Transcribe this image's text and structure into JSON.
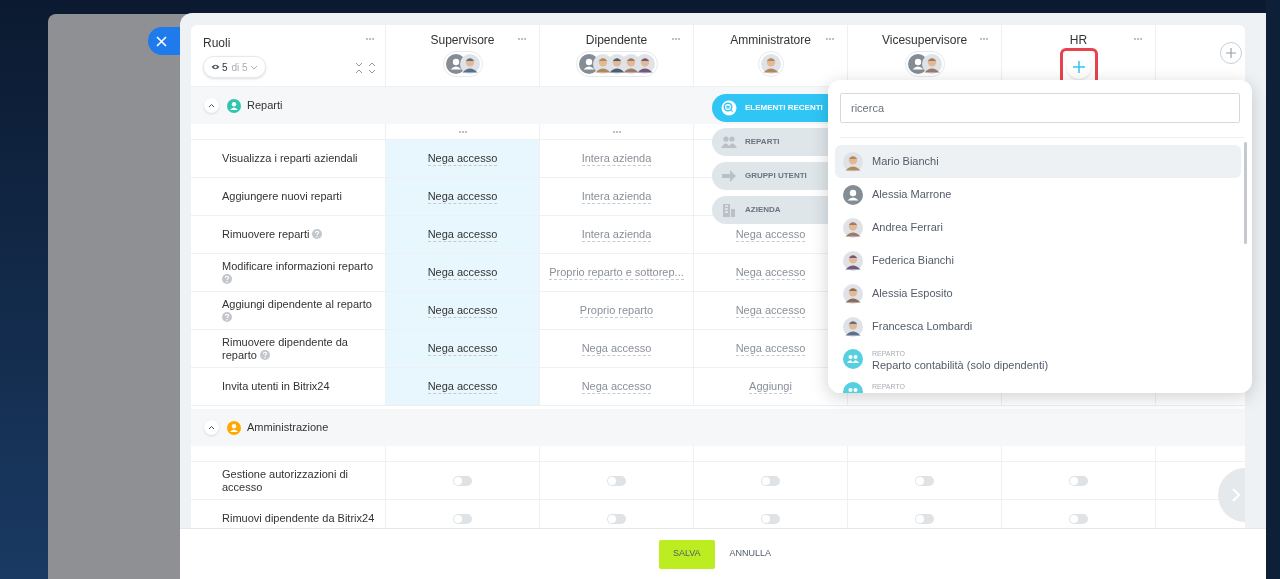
{
  "roles_header": {
    "title": "Ruoli",
    "visible_count": "5",
    "total": "di 5"
  },
  "roles": [
    {
      "name": "Supervisore",
      "members": [
        {
          "kind": "placeholder"
        },
        {
          "kind": "photo"
        }
      ]
    },
    {
      "name": "Dipendente",
      "members": [
        {
          "kind": "placeholder"
        },
        {
          "kind": "photo"
        },
        {
          "kind": "photo"
        },
        {
          "kind": "photo"
        },
        {
          "kind": "photo"
        }
      ]
    },
    {
      "name": "Amministratore",
      "members": [
        {
          "kind": "photo"
        }
      ]
    },
    {
      "name": "Vicesupervisore",
      "members": [
        {
          "kind": "placeholder"
        },
        {
          "kind": "photo"
        }
      ]
    },
    {
      "name": "HR",
      "highlighted": true
    }
  ],
  "sections": [
    {
      "title": "Reparti",
      "color": "#2fc6b0",
      "expanded": true,
      "rows": [
        {
          "label": "Visualizza i reparti aziendali",
          "help": false,
          "cells": [
            {
              "kind": "link",
              "text": "Nega accesso",
              "muted": false,
              "highlighted": true
            },
            {
              "kind": "link",
              "text": "Intera azienda",
              "muted": true,
              "highlighted": false
            }
          ]
        },
        {
          "label": "Aggiungere nuovi reparti",
          "help": false,
          "cells": [
            {
              "kind": "link",
              "text": "Nega accesso",
              "muted": false,
              "highlighted": true
            },
            {
              "kind": "link",
              "text": "Intera azienda",
              "muted": true,
              "highlighted": false
            }
          ]
        },
        {
          "label": "Rimuovere reparti",
          "help": true,
          "cells": [
            {
              "kind": "link",
              "text": "Nega accesso",
              "muted": false,
              "highlighted": true
            },
            {
              "kind": "link",
              "text": "Intera azienda",
              "muted": true,
              "highlighted": false
            },
            {
              "kind": "link",
              "text": "Nega accesso",
              "muted": true,
              "highlighted": false
            }
          ]
        },
        {
          "label": "Modificare informazioni reparto",
          "help": true,
          "cells": [
            {
              "kind": "link",
              "text": "Nega accesso",
              "muted": false,
              "highlighted": true
            },
            {
              "kind": "link",
              "text": "Proprio reparto e sottorep...",
              "muted": true,
              "highlighted": false
            },
            {
              "kind": "link",
              "text": "Nega accesso",
              "muted": true,
              "highlighted": false
            }
          ]
        },
        {
          "label": "Aggiungi dipendente al reparto",
          "help": true,
          "cells": [
            {
              "kind": "link",
              "text": "Nega accesso",
              "muted": false,
              "highlighted": true
            },
            {
              "kind": "link",
              "text": "Proprio reparto",
              "muted": true,
              "highlighted": false
            },
            {
              "kind": "link",
              "text": "Nega accesso",
              "muted": true,
              "highlighted": false
            }
          ]
        },
        {
          "label": "Rimuovere dipendente da reparto",
          "help": true,
          "cells": [
            {
              "kind": "link",
              "text": "Nega accesso",
              "muted": false,
              "highlighted": true
            },
            {
              "kind": "link",
              "text": "Nega accesso",
              "muted": true,
              "highlighted": false
            },
            {
              "kind": "link",
              "text": "Nega accesso",
              "muted": true,
              "highlighted": false
            }
          ]
        },
        {
          "label": "Invita utenti in Bitrix24",
          "help": false,
          "cells": [
            {
              "kind": "link",
              "text": "Nega accesso",
              "muted": false,
              "highlighted": true
            },
            {
              "kind": "link",
              "text": "Nega accesso",
              "muted": true,
              "highlighted": false
            },
            {
              "kind": "link",
              "text": "Aggiungi",
              "muted": true,
              "highlighted": false
            }
          ]
        }
      ]
    },
    {
      "title": "Amministrazione",
      "color": "#ffa900",
      "expanded": true,
      "rows": [
        {
          "label": "Gestione autorizzazioni di accesso",
          "help": false,
          "cells": [
            {
              "kind": "toggle",
              "on": false
            },
            {
              "kind": "toggle",
              "on": false
            },
            {
              "kind": "toggle",
              "on": false
            },
            {
              "kind": "toggle",
              "on": false
            },
            {
              "kind": "toggle",
              "on": false
            }
          ]
        },
        {
          "label": "Rimuovi dipendente da Bitrix24",
          "help": false,
          "cells": [
            {
              "kind": "toggle",
              "on": false
            },
            {
              "kind": "toggle",
              "on": false
            },
            {
              "kind": "toggle",
              "on": false
            },
            {
              "kind": "toggle",
              "on": false
            },
            {
              "kind": "toggle",
              "on": false
            }
          ]
        }
      ]
    }
  ],
  "picker": {
    "tabs": [
      {
        "label": "ELEMENTI RECENTI",
        "selected": true
      },
      {
        "label": "REPARTI",
        "selected": false
      },
      {
        "label": "GRUPPI UTENTI",
        "selected": false
      },
      {
        "label": "AZIENDA",
        "selected": false
      }
    ],
    "search": {
      "placeholder": "ricerca"
    },
    "items": [
      {
        "kind": "person",
        "photo": true,
        "name": "Mario Bianchi",
        "selected": true
      },
      {
        "kind": "person",
        "photo": false,
        "name": "Alessia Marrone",
        "selected": false
      },
      {
        "kind": "person",
        "photo": true,
        "name": "Andrea Ferrari",
        "selected": false
      },
      {
        "kind": "person",
        "photo": true,
        "name": "Federica Bianchi",
        "selected": false
      },
      {
        "kind": "person",
        "photo": true,
        "name": "Alessia Esposito",
        "selected": false
      },
      {
        "kind": "person",
        "photo": true,
        "name": "Francesca Lombardi",
        "selected": false
      },
      {
        "kind": "department",
        "category": "REPARTO",
        "name": "Reparto contabilità (solo dipendenti)",
        "selected": false
      },
      {
        "kind": "department",
        "category": "REPARTO",
        "selected": false
      }
    ]
  },
  "footer": {
    "buttons": [
      {
        "kind": "primary",
        "label": "SALVA"
      },
      {
        "kind": "link",
        "label": "ANNULLA"
      }
    ]
  }
}
